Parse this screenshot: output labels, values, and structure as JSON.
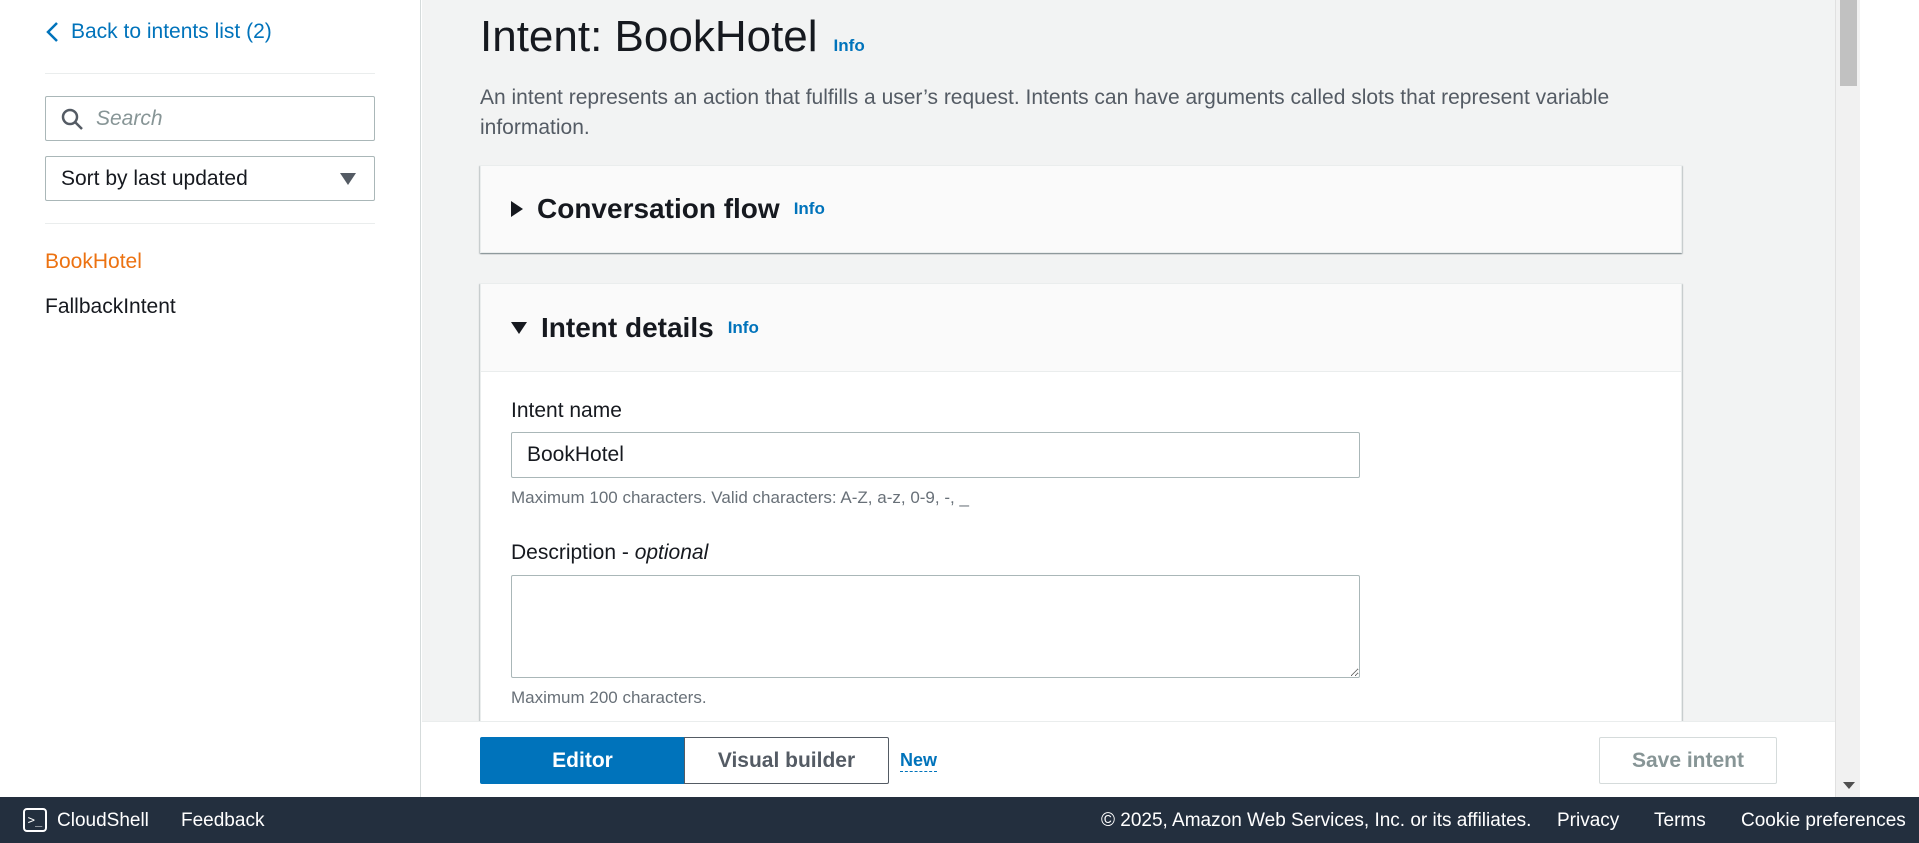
{
  "sidebar": {
    "back_link": "Back to intents list (2)",
    "search_placeholder": "Search",
    "sort_value": "Sort by last updated",
    "items": [
      {
        "label": "BookHotel",
        "active": true
      },
      {
        "label": "FallbackIntent",
        "active": false
      }
    ]
  },
  "header": {
    "title": "Intent: BookHotel",
    "info": "Info",
    "description": "An intent represents an action that fulfills a user’s request. Intents can have arguments called slots that represent variable information."
  },
  "conversation_flow": {
    "title": "Conversation flow",
    "info": "Info",
    "expanded": false
  },
  "intent_details": {
    "title": "Intent details",
    "info": "Info",
    "expanded": true,
    "name_label": "Intent name",
    "name_value": "BookHotel",
    "name_hint": "Maximum 100 characters. Valid characters: A-Z, a-z, 0-9, -, _",
    "desc_label": "Description - ",
    "desc_optional": "optional",
    "desc_value": "",
    "desc_hint": "Maximum 200 characters."
  },
  "editor_bar": {
    "editor_label": "Editor",
    "visual_label": "Visual builder",
    "new_label": "New",
    "save_label": "Save intent"
  },
  "console": {
    "cloudshell": "CloudShell",
    "feedback": "Feedback",
    "copyright": "© 2025, Amazon Web Services, Inc. or its affiliates.",
    "privacy": "Privacy",
    "terms": "Terms",
    "cookies": "Cookie preferences"
  },
  "colors": {
    "link": "#0073bb",
    "active_nav": "#ec7211",
    "console_bg": "#232f3e",
    "primary_button": "#0073bb"
  }
}
